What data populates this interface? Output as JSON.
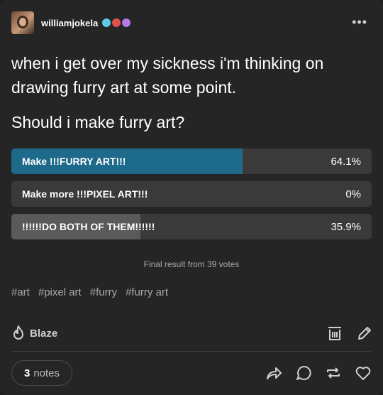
{
  "post": {
    "username": "williamjokela",
    "more_label": "•••",
    "body": "when i get over my sickness i'm thinking on drawing furry art at some point.",
    "question": "Should i make furry art?"
  },
  "poll": {
    "options": [
      {
        "label": "Make !!!FURRY ART!!!",
        "percent_text": "64.1%",
        "fraction": 0.641
      },
      {
        "label": "Make more !!!PIXEL ART!!!",
        "percent_text": "0%",
        "fraction": 0.0
      },
      {
        "label": "!!!!!!DO BOTH OF THEM!!!!!!",
        "percent_text": "35.9%",
        "fraction": 0.359
      }
    ],
    "winner_color": "#1d6a8a",
    "other_color": "#5a5a5a",
    "result_text": "Final result from 39 votes"
  },
  "tags": [
    "#art",
    "#pixel art",
    "#furry",
    "#furry art"
  ],
  "footer": {
    "blaze_label": "Blaze",
    "notes_count": "3",
    "notes_label": "notes"
  }
}
